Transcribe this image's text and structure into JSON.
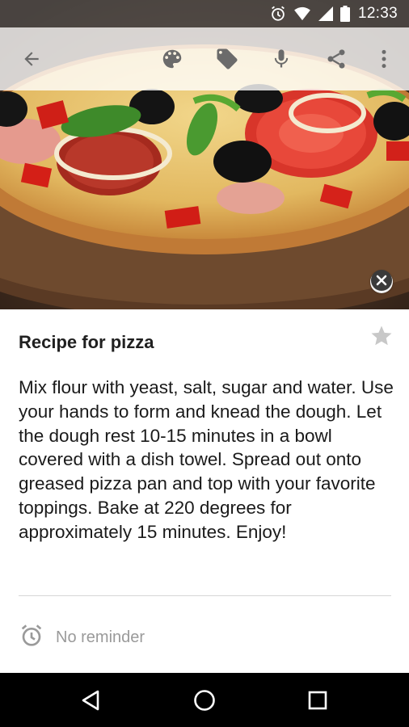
{
  "status_bar": {
    "time": "12:33",
    "icons": [
      "alarm-icon",
      "wifi-icon",
      "signal-icon",
      "battery-icon"
    ]
  },
  "toolbar": {
    "icons": [
      "back-arrow-icon",
      "palette-icon",
      "label-icon",
      "mic-icon",
      "share-icon",
      "more-vert-icon"
    ]
  },
  "note": {
    "title": "Recipe for pizza",
    "body": "Mix flour with yeast, salt, sugar and water. Use your hands to form and knead the dough. Let the dough rest 10-15 minutes in a bowl covered with a dish towel. Spread out onto greased pizza pan and top with your favorite toppings. Bake at 220 degrees for approximately 15 minutes. Enjoy!",
    "reminder_label": "No reminder"
  },
  "nav_bar": {
    "icons": [
      "back-triangle-icon",
      "home-circle-icon",
      "recents-square-icon"
    ]
  },
  "colors": {
    "icon_gray": "#6b6b6b",
    "star_gray": "#c8c8c8",
    "text": "#1a1a1a",
    "muted": "#9a9a9a"
  }
}
